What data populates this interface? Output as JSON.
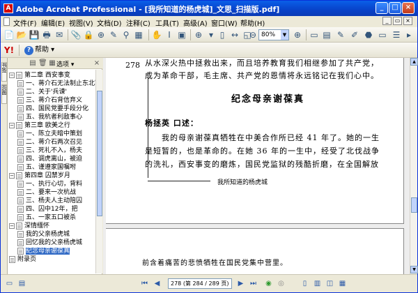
{
  "titlebar": {
    "title": "Adobe Acrobat Professional - [我所知道的杨虎城]_文思_扫描版.pdf]",
    "minimize": "_",
    "restore": "□",
    "close": "×"
  },
  "menubar": {
    "items": [
      "文件(F)",
      "编辑(E)",
      "视图(V)",
      "文档(D)",
      "注释(C)",
      "工具(T)",
      "高级(A)",
      "窗口(W)",
      "帮助(H)"
    ],
    "mdi_min": "_",
    "mdi_restore": "▭",
    "mdi_close": "×"
  },
  "toolbar2": {
    "help_label": "帮助",
    "zoom": "80%"
  },
  "sidebar": {
    "tabs": [
      "书签",
      "页面"
    ],
    "options_label": "选项",
    "items": [
      {
        "kind": "chapter",
        "label": "第二章 西安事变"
      },
      {
        "kind": "page",
        "label": "一、蒋介石无法制止东北军"
      },
      {
        "kind": "page",
        "label": "二、关于'兵谏'"
      },
      {
        "kind": "page",
        "label": "三、蒋介石背信弃义"
      },
      {
        "kind": "page",
        "label": "四、国民党要手段分化"
      },
      {
        "kind": "page",
        "label": "五、我杭者利敌事心"
      },
      {
        "kind": "chapter",
        "label": "第三章 欧美之行"
      },
      {
        "kind": "page",
        "label": "一、陈立夫暗中策划"
      },
      {
        "kind": "page",
        "label": "二、蒋介石两次召见"
      },
      {
        "kind": "page",
        "label": "三、死礼不入，杨夫"
      },
      {
        "kind": "page",
        "label": "四、调虎离山，被迫"
      },
      {
        "kind": "page",
        "label": "五、谨遵家国嘱咐"
      },
      {
        "kind": "chapter",
        "label": "第四章 囚禁岁月"
      },
      {
        "kind": "page",
        "label": "一、执行心切，背料"
      },
      {
        "kind": "page",
        "label": "二、要来一次杭战"
      },
      {
        "kind": "page",
        "label": "三、杨夫人主动陪囚"
      },
      {
        "kind": "page",
        "label": "四、囚中12年，把"
      },
      {
        "kind": "page",
        "label": "五、一家五口被杀"
      },
      {
        "kind": "chapter",
        "label": "深情缅怀"
      },
      {
        "kind": "page",
        "label": "我的父亲杨虎城"
      },
      {
        "kind": "page",
        "label": "回忆我的父亲杨虎城"
      },
      {
        "kind": "page",
        "label": "纪念母亲谢葆真",
        "selected": true
      },
      {
        "kind": "chapter-leaf",
        "label": "附录页"
      }
    ]
  },
  "document": {
    "page_number": "278",
    "lines": [
      "从水深火热中拯救出来，而且培养教育我们相继参加了共产党，",
      "成为革命干部，毛主席、共产党的恩情将永远铭记在我们心中。"
    ],
    "heading": "纪念母亲谢葆真",
    "byline": "杨拯英 口述：",
    "paragraph": [
      "我的母亲谢葆真牺牲在中美合作所已经 41 年了。她的一生",
      "是短暂的，也是革命的。在她 36 年的一生中，经受了北伐战争",
      "的洗礼，西安事变的磨炼，国民党监狱的残酷折磨，在全国解放"
    ],
    "footnote": "我所知道的杨虎城",
    "page2_line": "前含着痛苦的悲愤牺牲在国民党集中营里。"
  },
  "statusbar": {
    "page_display": "278 (第 284 / 289 页)"
  }
}
